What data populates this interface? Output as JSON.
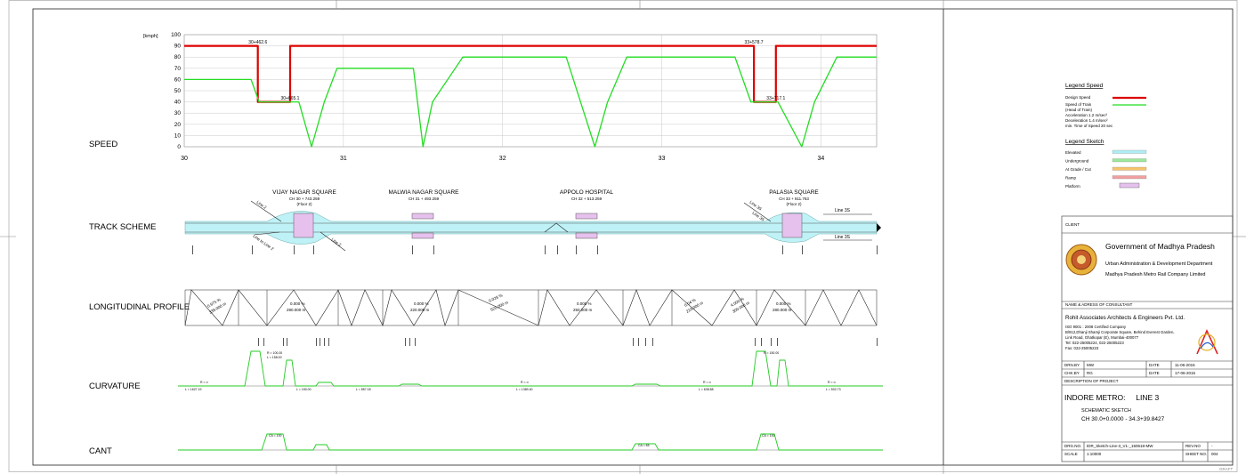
{
  "rows": {
    "speed": "SPEED",
    "track": "TRACK SCHEME",
    "profile": "LONGITUDINAL PROFILE",
    "curvature": "CURVATURE",
    "cant": "CANT"
  },
  "chart_data": {
    "type": "line",
    "title": "",
    "ylabel": "[kmph]",
    "xlabel": "",
    "ylim": [
      0,
      100
    ],
    "yticks": [
      0,
      10,
      20,
      30,
      40,
      50,
      60,
      70,
      80,
      90,
      100
    ],
    "xlim": [
      30,
      34.35
    ],
    "xticks": [
      30,
      31,
      32,
      33,
      34
    ],
    "grid": true,
    "series": [
      {
        "name": "Design Speed",
        "color": "#dd0000",
        "x": [
          30.0,
          30.4626,
          30.4626,
          30.6651,
          30.6651,
          33.5787,
          33.5787,
          33.7171,
          33.7171,
          34.35
        ],
        "y": [
          90,
          90,
          40,
          40,
          90,
          90,
          40,
          40,
          90,
          90
        ]
      },
      {
        "name": "Speed of Train",
        "color": "#22dd22",
        "x": [
          30.0,
          30.42,
          30.47,
          30.72,
          30.8,
          30.88,
          30.96,
          31.44,
          31.5,
          31.56,
          31.75,
          32.4,
          32.58,
          32.66,
          32.78,
          33.46,
          33.56,
          33.73,
          33.88,
          33.96,
          34.1,
          34.35
        ],
        "y": [
          60,
          60,
          40,
          40,
          0,
          40,
          70,
          70,
          0,
          40,
          80,
          80,
          0,
          40,
          80,
          80,
          40,
          40,
          0,
          40,
          80,
          80
        ]
      }
    ],
    "annotations": [
      {
        "text": "30+462.6",
        "x": 30.4626,
        "y": 90
      },
      {
        "text": "30+665.1",
        "x": 30.6651,
        "y": 40
      },
      {
        "text": "33+578.7",
        "x": 33.5787,
        "y": 90
      },
      {
        "text": "33+717.1",
        "x": 33.7171,
        "y": 40
      }
    ]
  },
  "stations": [
    {
      "name": "VIJAY NAGAR SQUARE",
      "ch": "CH  30 + 743.259",
      "floor": "(Floor 2)"
    },
    {
      "name": "MALWIA NAGAR SQUARE",
      "ch": "CH  31 + 493.259",
      "floor": ""
    },
    {
      "name": "APPOLO HOSPITAL",
      "ch": "CH  32 + 513.259",
      "floor": ""
    },
    {
      "name": "PALASIA SQUARE",
      "ch": "CH  33 + 811.763",
      "floor": "(Floor 2)"
    }
  ],
  "track_labels": {
    "line2_top": "Line 2",
    "line2_bottom": "Line 2",
    "line2_to": "Line to Line 2",
    "line3s_top": "Line 3S",
    "line3s_mid": "Line 3S",
    "line3s_r1": "Line 3S",
    "line3s_r2": "Line 3S"
  },
  "profile_labels": {
    "g1": "0.975 %",
    "g1l": "339.000 m",
    "g2": "0.000 %",
    "g2l": "290.000 m",
    "g3": "0.000 %",
    "g3l": "220.000 m",
    "g4": "0.000 %",
    "g4l": "250.000 m",
    "g5": "0.000 %",
    "g5l": "280.000 m",
    "g6": "0.028 %",
    "g6l": "520.000 m",
    "g7": "4.000 %",
    "g7l": "300.000 m",
    "g8": "0.04 %",
    "g8l": "210.000 m"
  },
  "curvature_labels": {
    "r1": "R = 100.00",
    "l1": "L = 158.00",
    "r2": "R = 150.00",
    "c1": "L = 1627.19",
    "c2": "L = 150.00",
    "c3": "L = 857.18",
    "c4": "L = 1389.40",
    "c5": "L = 638.88",
    "c6": "L = 502.73",
    "rc": "R = ∞"
  },
  "cant_labels": {
    "c1": "CA = 100",
    "c2": "CA = 65",
    "c3": "CA = 100"
  },
  "legend_speed": {
    "title": "Legend Speed",
    "design": "Design Speed",
    "train": "Speed of Train",
    "train2": "(Head of Train)",
    "accel": "Acceleration 1.2 m/sec²",
    "decel": "Deceleration 1.4 m/sec²",
    "time": "min. Time of Speed 20 sec"
  },
  "legend_sketch": {
    "title": "Legend Sketch",
    "items": [
      "Elevated",
      "Underground",
      "At Grade / Cut",
      "Ramp",
      "Platform"
    ],
    "colors": [
      "#aeeef4",
      "#9be89b",
      "#f6c36b",
      "#f0a0a0",
      "#e7c1ee"
    ]
  },
  "title_block": {
    "client_label": "CLIENT",
    "client_name": "Government of Madhya Pradesh",
    "client_dept": "Urban Administration & Development Department",
    "client_co": "Madhya Pradesh Metro Rail Company Limited",
    "consultant_label": "NAME & ADRESS OF CONSULTANT",
    "consultant_name": "Rohit Associates Architects & Engineers Pvt. Ltd.",
    "consultant_lines": [
      "ISO 9001 : 2008 Certified Company",
      "B/912,Dhanji Shamji Corporate Square, Behind Everest Garden,",
      "Link Road, Ghatkopar (E), Mumbai-400077",
      "Tel: 022-25005224, 022-25005223",
      "Fax: 022-25005223"
    ],
    "drn_by_label": "DRN.BY",
    "drn_by": "MW",
    "chk_by_label": "CHK.BY",
    "chk_by": "RG",
    "date_label": "DATE",
    "date1": "11-06-2015",
    "date2": "17-06-2015",
    "desc_label": "DESCRIPTION OF PROJECT",
    "project": "INDORE METRO:     LINE 3",
    "sketch": "SCHEMATIC SKETCH",
    "chainage": "CH 30.0+0.0000 - 34.3+39.8427",
    "drg_no_label": "DRG.NO.",
    "drg_no": "IDR_Sketch-Line-3_V1-_150618-MW",
    "rev_label": "REV.NO",
    "rev": "-",
    "scale_label": "SCALE",
    "scale": "1:10000",
    "sheet_label": "SHEET NO.",
    "sheet": "004"
  },
  "colors": {
    "design_speed": "#dd0000",
    "train_speed": "#22dd22",
    "elevated": "#aeeef4",
    "platform": "#e7c1ee"
  }
}
